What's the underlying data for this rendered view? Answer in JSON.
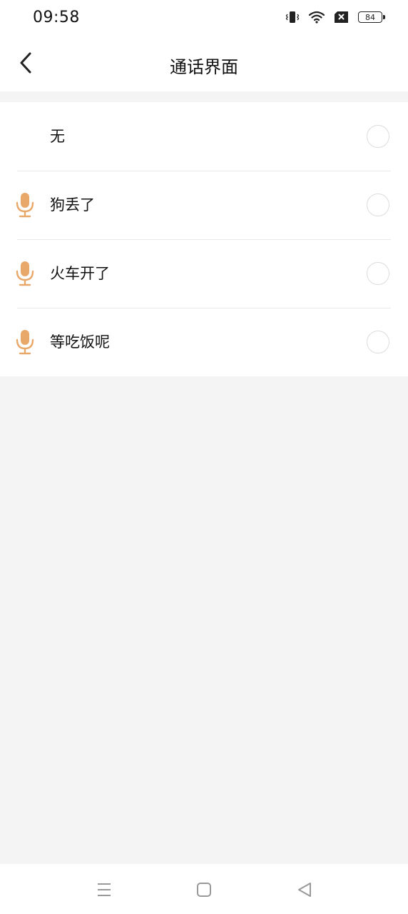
{
  "status_bar": {
    "time": "09:58",
    "battery_level": "84",
    "icons": [
      "vibrate-icon",
      "wifi-icon",
      "sim-off-icon",
      "battery-icon"
    ]
  },
  "header": {
    "title": "通话界面",
    "back_icon": "chevron-left-icon"
  },
  "options": [
    {
      "label": "无",
      "has_mic": false,
      "selected": false
    },
    {
      "label": "狗丢了",
      "has_mic": true,
      "selected": false
    },
    {
      "label": "火车开了",
      "has_mic": true,
      "selected": false
    },
    {
      "label": "等吃饭呢",
      "has_mic": true,
      "selected": false
    }
  ],
  "nav_bar": {
    "buttons": [
      "menu-icon",
      "home-icon",
      "back-triangle-icon"
    ]
  },
  "colors": {
    "accent_mic": "#e8a86a",
    "background": "#f4f4f4",
    "surface": "#ffffff",
    "divider": "#e9e9e9"
  }
}
